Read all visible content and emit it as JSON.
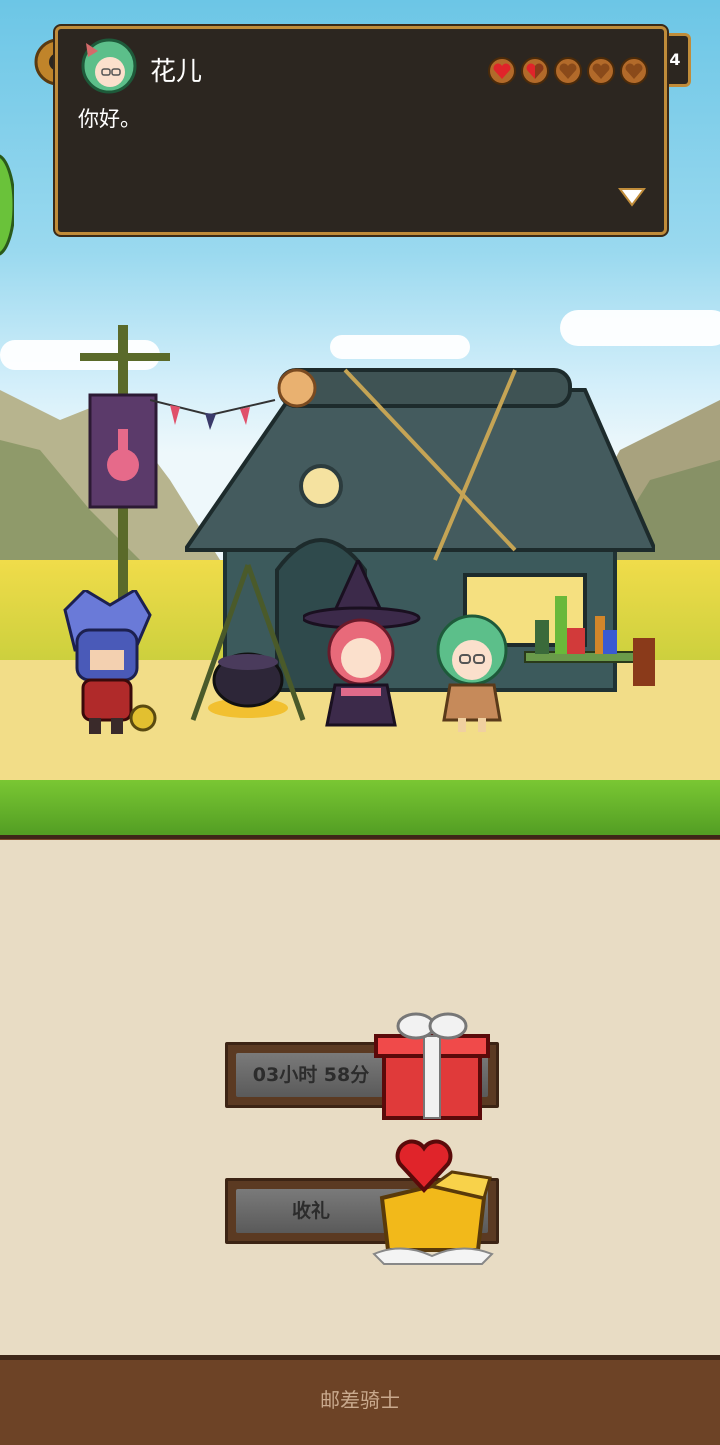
{
  "dialog": {
    "speaker_name": "花儿",
    "text": "你好。",
    "affection": {
      "filled": 1,
      "partial": 1,
      "total": 5
    },
    "level_partial": "4"
  },
  "gift": {
    "timer_label": "03小时 58分",
    "claim_label": "收礼"
  },
  "footer": {
    "title": "邮差骑士"
  },
  "colors": {
    "dialog_bg": "#2c2620",
    "dialog_border": "#c08c3a",
    "heart_full": "#e0242a",
    "bar_grey": "#6a6a6a",
    "panel_bg": "#e8dcc4",
    "dirt": "#7a4b2c"
  },
  "icons": {
    "gift": "red-gift-box-icon",
    "claim": "heart-box-icon",
    "next": "triangle-down-icon",
    "settings": "gear-icon"
  }
}
